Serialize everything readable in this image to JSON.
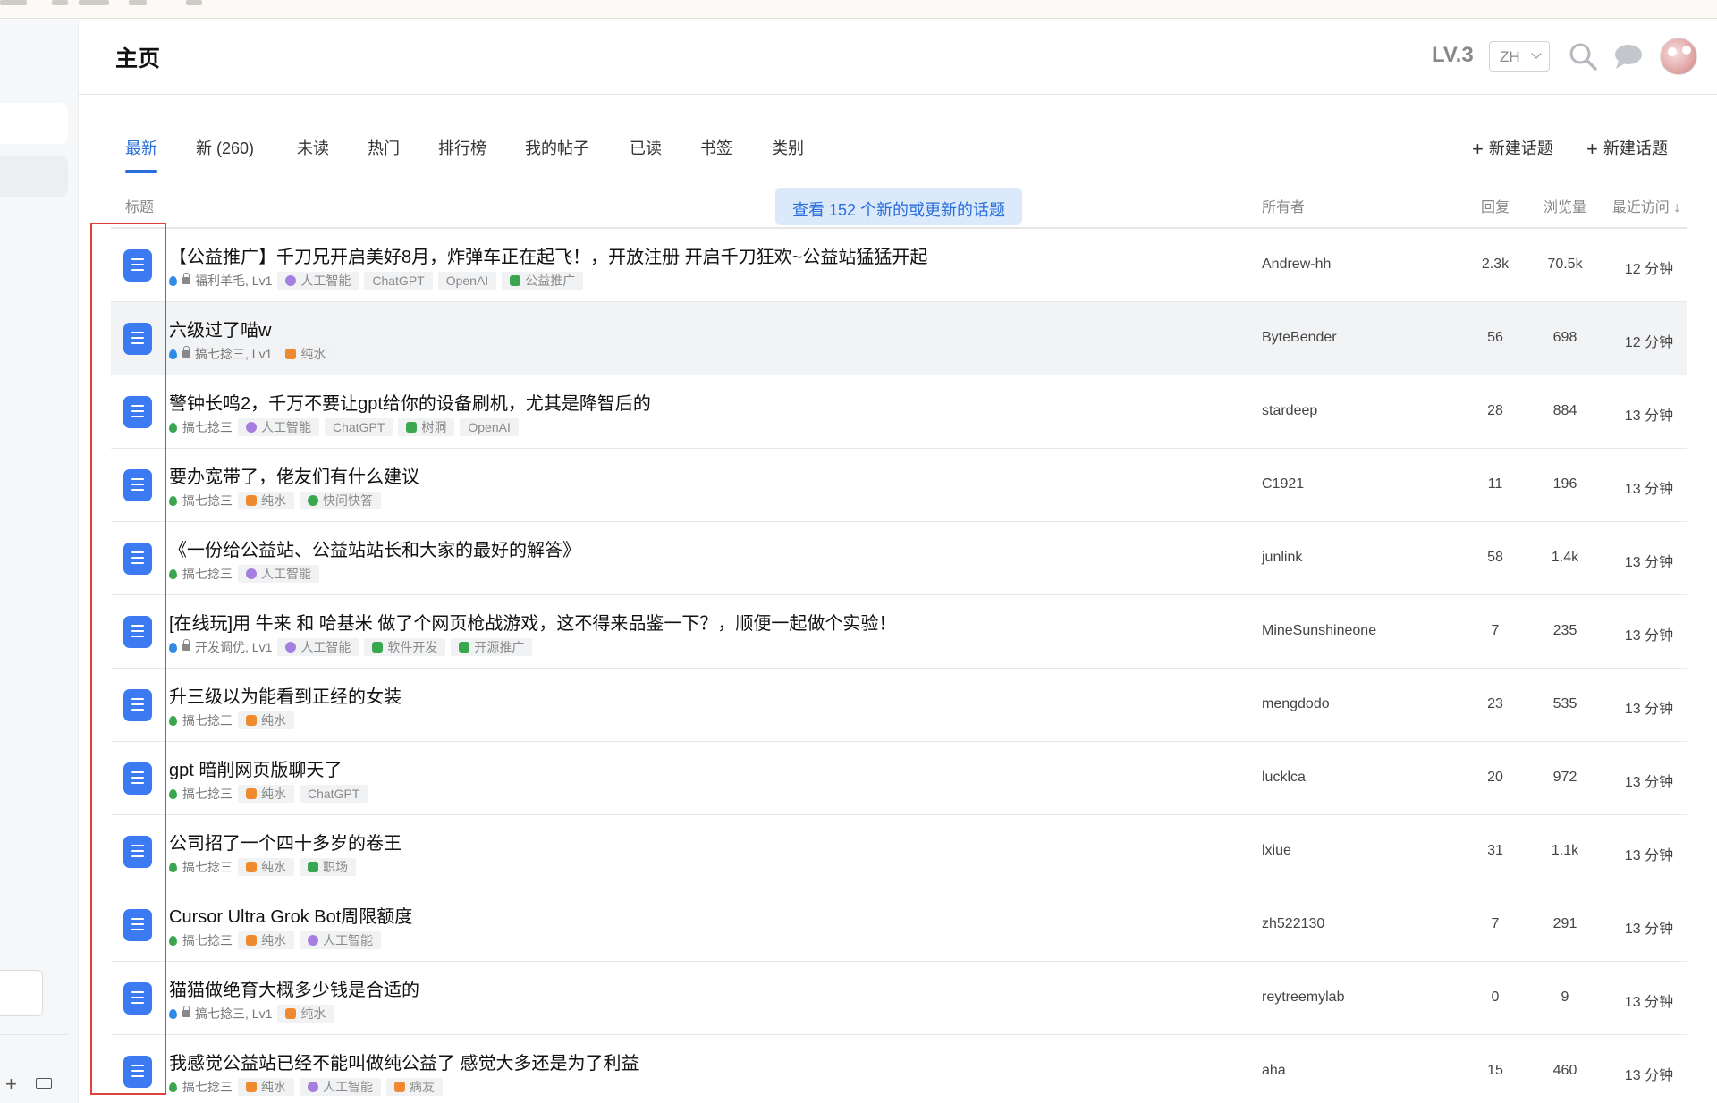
{
  "header": {
    "title": "主页",
    "level": "LV.3",
    "language": "ZH",
    "icons": [
      "search-icon",
      "chat-icon"
    ]
  },
  "tabs": [
    "最新",
    "新 (260)",
    "未读",
    "热门",
    "排行榜",
    "我的帖子",
    "已读",
    "书签",
    "类别"
  ],
  "active_tab": "最新",
  "actions": {
    "new_topic_1": "新建话题",
    "new_topic_2": "新建话题"
  },
  "table": {
    "headers": {
      "title": "标题",
      "owner": "所有者",
      "replies": "回复",
      "views": "浏览量",
      "activity": "最近访问 ↓"
    },
    "notice": "查看 152 个新的或更新的话题"
  },
  "colors": {
    "accent": "#2a6fdb",
    "doc_icon": "#3b7af0",
    "highlight": "#e0403a"
  },
  "topics": [
    {
      "title": "【公益推广】千刀兄开启美好8月，炸弹车正在起飞！，开放注册 开启千刀狂欢~公益站猛猛开起",
      "category": "福利羊毛, Lv1",
      "category_color": "#2f8be6",
      "locked": true,
      "tags": [
        {
          "icon": "brain-icon",
          "label": "人工智能"
        },
        {
          "icon": "",
          "label": "ChatGPT"
        },
        {
          "icon": "",
          "label": "OpenAI"
        },
        {
          "icon": "doc-green-icon",
          "label": "公益推广"
        }
      ],
      "owner": "Andrew-hh",
      "replies": "2.3k",
      "views": "70.5k",
      "activity": "12 分钟"
    },
    {
      "title": "六级过了喵w",
      "category": "搞七捻三, Lv1",
      "category_color": "#2f8be6",
      "locked": true,
      "tags": [
        {
          "icon": "faucet-icon",
          "label": "纯水"
        }
      ],
      "owner": "ByteBender",
      "replies": "56",
      "views": "698",
      "activity": "12 分钟"
    },
    {
      "title": "警钟长鸣2，千万不要让gpt给你的设备刷机，尤其是降智后的",
      "category": "搞七捻三",
      "category_color": "#3aa64f",
      "locked": false,
      "tags": [
        {
          "icon": "brain-icon",
          "label": "人工智能"
        },
        {
          "icon": "",
          "label": "ChatGPT"
        },
        {
          "icon": "tree-icon",
          "label": "树洞"
        },
        {
          "icon": "",
          "label": "OpenAI"
        }
      ],
      "owner": "stardeep",
      "replies": "28",
      "views": "884",
      "activity": "13 分钟"
    },
    {
      "title": "要办宽带了，佬友们有什么建议",
      "category": "搞七捻三",
      "category_color": "#3aa64f",
      "locked": false,
      "tags": [
        {
          "icon": "faucet-icon",
          "label": "纯水"
        },
        {
          "icon": "question-icon",
          "label": "快问快答"
        }
      ],
      "owner": "C1921",
      "replies": "11",
      "views": "196",
      "activity": "13 分钟"
    },
    {
      "title": "《一份给公益站、公益站站长和大家的最好的解答》",
      "category": "搞七捻三",
      "category_color": "#3aa64f",
      "locked": false,
      "tags": [
        {
          "icon": "brain-icon",
          "label": "人工智能"
        }
      ],
      "owner": "junlink",
      "replies": "58",
      "views": "1.4k",
      "activity": "13 分钟"
    },
    {
      "title": "[在线玩]用 牛来 和 哈基米 做了个网页枪战游戏，这不得来品鉴一下？，顺便一起做个实验！",
      "category": "开发调优, Lv1",
      "category_color": "#2f8be6",
      "locked": true,
      "tags": [
        {
          "icon": "brain-icon",
          "label": "人工智能"
        },
        {
          "icon": "doc-green-icon",
          "label": "软件开发"
        },
        {
          "icon": "doc-green-icon",
          "label": "开源推广"
        }
      ],
      "owner": "MineSunshineone",
      "replies": "7",
      "views": "235",
      "activity": "13 分钟"
    },
    {
      "title": "升三级以为能看到正经的女装",
      "category": "搞七捻三",
      "category_color": "#3aa64f",
      "locked": false,
      "tags": [
        {
          "icon": "faucet-icon",
          "label": "纯水"
        }
      ],
      "owner": "mengdodo",
      "replies": "23",
      "views": "535",
      "activity": "13 分钟"
    },
    {
      "title": "gpt 暗削网页版聊天了",
      "category": "搞七捻三",
      "category_color": "#3aa64f",
      "locked": false,
      "tags": [
        {
          "icon": "faucet-icon",
          "label": "纯水"
        },
        {
          "icon": "",
          "label": "ChatGPT"
        }
      ],
      "owner": "lucklca",
      "replies": "20",
      "views": "972",
      "activity": "13 分钟"
    },
    {
      "title": "公司招了一个四十多岁的卷王",
      "category": "搞七捻三",
      "category_color": "#3aa64f",
      "locked": false,
      "tags": [
        {
          "icon": "faucet-icon",
          "label": "纯水"
        },
        {
          "icon": "briefcase-icon",
          "label": "职场"
        }
      ],
      "owner": "lxiue",
      "replies": "31",
      "views": "1.1k",
      "activity": "13 分钟"
    },
    {
      "title": "Cursor Ultra Grok Bot周限额度",
      "category": "搞七捻三",
      "category_color": "#3aa64f",
      "locked": false,
      "tags": [
        {
          "icon": "faucet-icon",
          "label": "纯水"
        },
        {
          "icon": "brain-icon",
          "label": "人工智能"
        }
      ],
      "owner": "zh522130",
      "replies": "7",
      "views": "291",
      "activity": "13 分钟"
    },
    {
      "title": "猫猫做绝育大概多少钱是合适的",
      "category": "搞七捻三, Lv1",
      "category_color": "#2f8be6",
      "locked": true,
      "tags": [
        {
          "icon": "faucet-icon",
          "label": "纯水"
        }
      ],
      "owner": "reytreemylab",
      "replies": "0",
      "views": "9",
      "activity": "13 分钟"
    },
    {
      "title": "我感觉公益站已经不能叫做纯公益了 感觉大多还是为了利益",
      "category": "搞七捻三",
      "category_color": "#3aa64f",
      "locked": false,
      "tags": [
        {
          "icon": "faucet-icon",
          "label": "纯水"
        },
        {
          "icon": "brain-icon",
          "label": "人工智能"
        },
        {
          "icon": "patient-icon",
          "label": "病友"
        }
      ],
      "owner": "aha",
      "replies": "15",
      "views": "460",
      "activity": "13 分钟"
    }
  ]
}
